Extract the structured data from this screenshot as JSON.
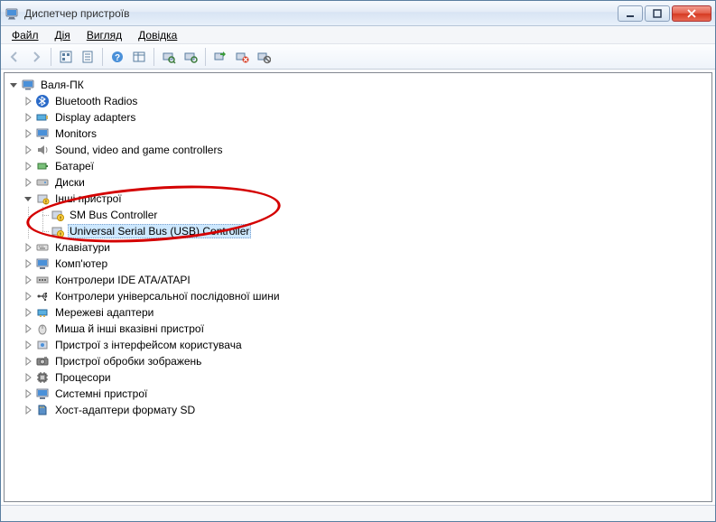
{
  "window": {
    "title": "Диспетчер пристроїв"
  },
  "menu": {
    "file": "Файл",
    "action": "Дія",
    "view": "Вигляд",
    "help": "Довідка"
  },
  "tree": {
    "root": "Валя-ПК",
    "bluetooth": "Bluetooth Radios",
    "display": "Display adapters",
    "monitors": "Monitors",
    "sound": "Sound, video and game controllers",
    "batteries": "Батареї",
    "disks": "Диски",
    "other": "Інші пристрої",
    "other_sm": "SM Bus Controller",
    "other_usb": "Universal Serial Bus (USB) Controller",
    "keyboards": "Клавіатури",
    "computer": "Комп'ютер",
    "ide": "Контролери IDE ATA/ATAPI",
    "usb_ctrl": "Контролери універсальної послідовної шини",
    "network": "Мережеві адаптери",
    "mice": "Миша й інші вказівні пристрої",
    "hid": "Пристрої з інтерфейсом користувача",
    "imaging": "Пристрої обробки зображень",
    "processors": "Процесори",
    "system": "Системні пристрої",
    "sd": "Хост-адаптери формату SD"
  }
}
